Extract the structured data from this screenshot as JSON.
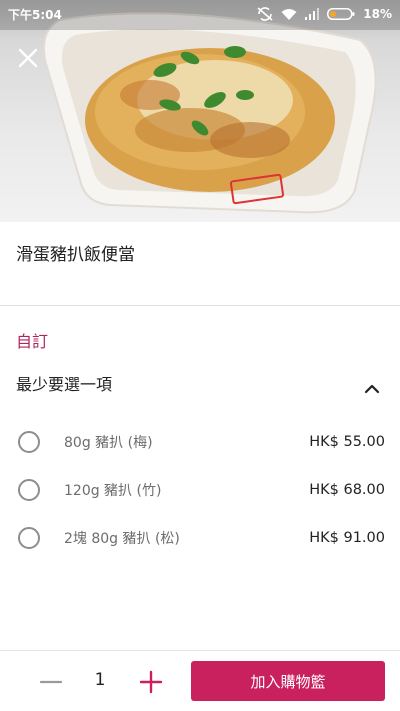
{
  "status_bar": {
    "time": "下午5:04",
    "battery": "18%"
  },
  "product": {
    "name": "滑蛋豬扒飯便當"
  },
  "customization": {
    "section_label": "自訂",
    "requirement": "最少要選一項",
    "options": [
      {
        "label": "80g 豬扒 (梅)",
        "price": "HK$ 55.00"
      },
      {
        "label": "120g 豬扒 (竹)",
        "price": "HK$ 68.00"
      },
      {
        "label": "2塊 80g 豬扒 (松)",
        "price": "HK$ 91.00"
      }
    ]
  },
  "cart": {
    "quantity": "1",
    "add_label": "加入購物籃"
  },
  "colors": {
    "accent": "#c9215d",
    "section_label": "#b0245d"
  },
  "icons": [
    "close-icon",
    "chevron-up-icon",
    "minus-icon",
    "plus-icon",
    "wifi-icon",
    "signal-icon",
    "battery-icon",
    "sync-off-icon"
  ]
}
